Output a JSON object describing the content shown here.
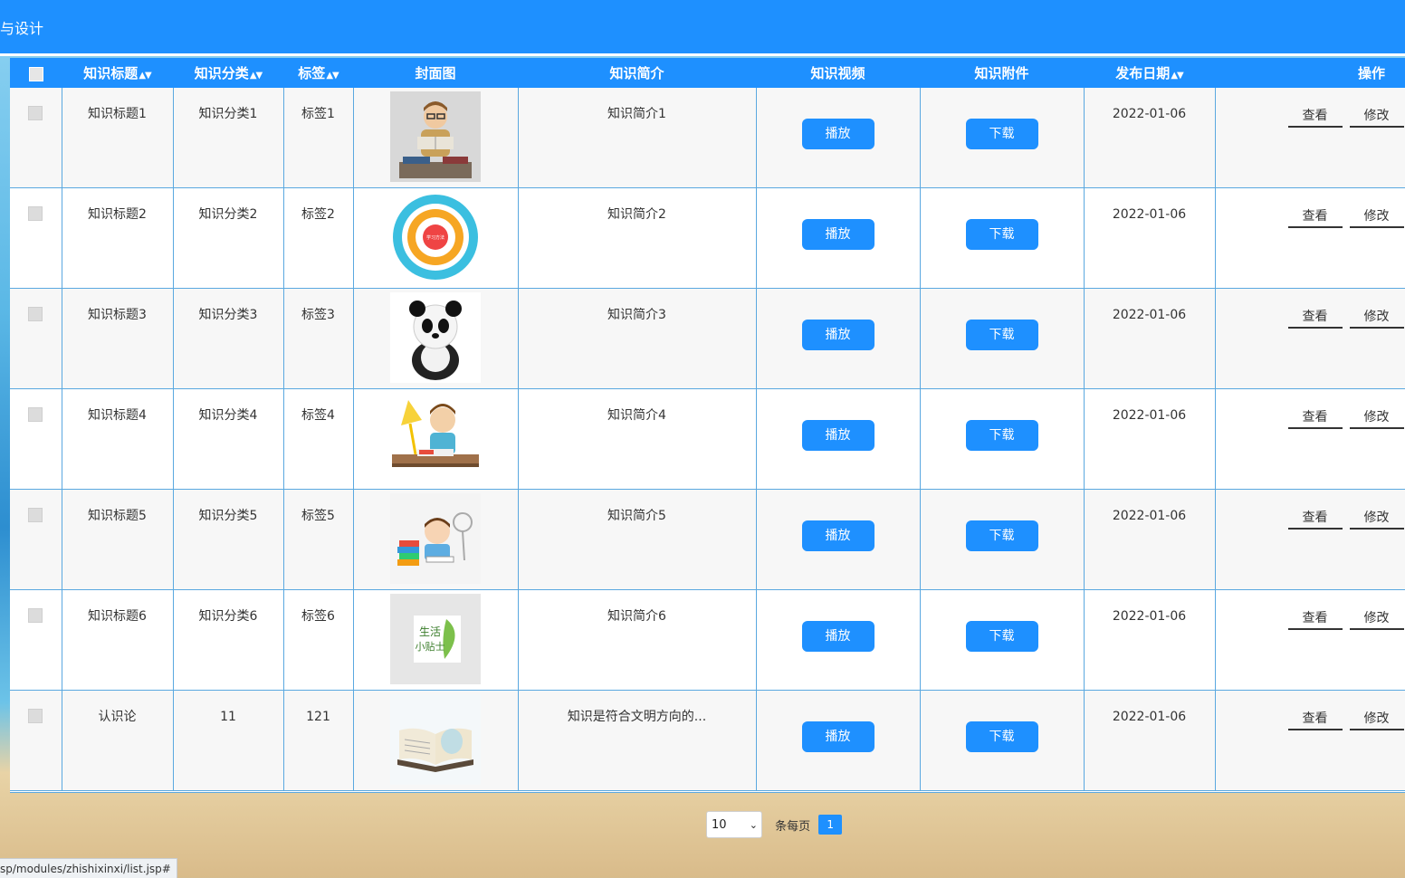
{
  "header": {
    "title": "与设计"
  },
  "table": {
    "columns": [
      "知识标题",
      "知识分类",
      "标签",
      "封面图",
      "知识简介",
      "知识视频",
      "知识附件",
      "发布日期",
      "操作"
    ],
    "play_label": "播放",
    "download_label": "下载",
    "view_label": "查看",
    "edit_label": "修改",
    "rows": [
      {
        "title": "知识标题1",
        "category": "知识分类1",
        "tag": "标签1",
        "intro": "知识简介1",
        "date": "2022-01-06",
        "cover": "reading-man-image"
      },
      {
        "title": "知识标题2",
        "category": "知识分类2",
        "tag": "标签2",
        "intro": "知识简介2",
        "date": "2022-01-06",
        "cover": "circle-diagram-image"
      },
      {
        "title": "知识标题3",
        "category": "知识分类3",
        "tag": "标签3",
        "intro": "知识简介3",
        "date": "2022-01-06",
        "cover": "panda-image"
      },
      {
        "title": "知识标题4",
        "category": "知识分类4",
        "tag": "标签4",
        "intro": "知识简介4",
        "date": "2022-01-06",
        "cover": "student-desk-image"
      },
      {
        "title": "知识标题5",
        "category": "知识分类5",
        "tag": "标签5",
        "intro": "知识简介5",
        "date": "2022-01-06",
        "cover": "kid-books-image"
      },
      {
        "title": "知识标题6",
        "category": "知识分类6",
        "tag": "标签6",
        "intro": "知识简介6",
        "date": "2022-01-06",
        "cover": "life-tips-image"
      },
      {
        "title": "认识论",
        "category": "11",
        "tag": "121",
        "intro": "知识是符合文明方向的...",
        "date": "2022-01-06",
        "cover": "open-book-image"
      }
    ]
  },
  "pager": {
    "page_size": "10",
    "per_page_label": "条每页",
    "current_page": "1"
  },
  "status_bar": {
    "url": "sp/modules/zhishixinxi/list.jsp#"
  },
  "colors": {
    "primary": "#1e90ff",
    "border": "#5aa8e0"
  },
  "cover_texts": {
    "circle_center": "学习方法",
    "life_tips_line1": "生活",
    "life_tips_line2": "小贴士"
  }
}
